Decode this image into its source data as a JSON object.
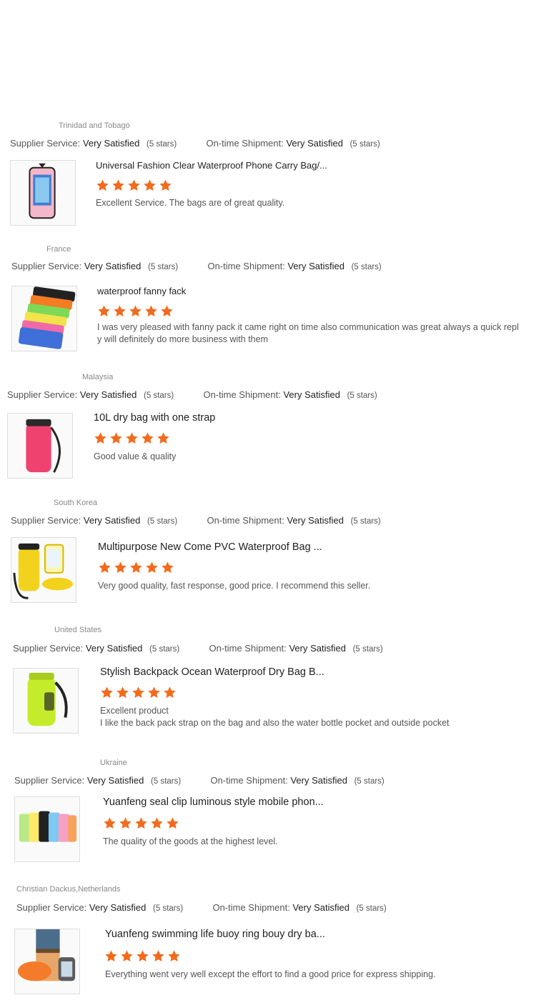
{
  "labels": {
    "supplier": "Supplier Service:",
    "shipment": "On-time Shipment:"
  },
  "colors": {
    "star": "#f26b1d",
    "accent_text": "#222222"
  },
  "reviews": [
    {
      "country": "Trinidad and Tobago",
      "supplier_value": "Very Satisfied",
      "supplier_stars": "(5 stars)",
      "shipment_value": "Very Satisfied",
      "shipment_stars": "(5 stars)",
      "product_title": "Universal Fashion Clear Waterproof Phone Carry Bag/...",
      "rating": 5,
      "comment_lines": [
        "Excellent Service. The bags are of great quality."
      ],
      "thumb_icon": "clear-phone-pouch-image"
    },
    {
      "country": "France",
      "supplier_value": "Very Satisfied",
      "supplier_stars": "(5 stars)",
      "shipment_value": "Very Satisfied",
      "shipment_stars": "(5 stars)",
      "product_title": "waterproof fanny fack",
      "rating": 5,
      "comment_lines": [
        "I was very pleased with fanny pack it came right on time also communication was great always a quick repl",
        "y will definitely do more business with them"
      ],
      "thumb_icon": "fanny-pack-image"
    },
    {
      "country": "Malaysia",
      "supplier_value": "Very Satisfied",
      "supplier_stars": "(5 stars)",
      "shipment_value": "Very Satisfied",
      "shipment_stars": "(5 stars)",
      "product_title": "10L dry bag with one strap",
      "rating": 5,
      "comment_lines": [
        "Good value & quality"
      ],
      "thumb_icon": "pink-dry-bag-image"
    },
    {
      "country": "South Korea",
      "supplier_value": "Very Satisfied",
      "supplier_stars": "(5 stars)",
      "shipment_value": "Very Satisfied",
      "shipment_stars": "(5 stars)",
      "product_title": "Multipurpose New Come PVC Waterproof Bag ...",
      "rating": 5,
      "comment_lines": [
        "Very good quality, fast response, good price. I recommend this seller."
      ],
      "thumb_icon": "yellow-bag-set-image"
    },
    {
      "country": "United States",
      "supplier_value": "Very Satisfied",
      "supplier_stars": "(5 stars)",
      "shipment_value": "Very Satisfied",
      "shipment_stars": "(5 stars)",
      "product_title": "Stylish Backpack Ocean Waterproof Dry Bag B...",
      "rating": 5,
      "comment_lines": [
        "Excellent product",
        "I like the back pack strap on the bag and also the water bottle pocket and outside pocket"
      ],
      "thumb_icon": "green-backpack-image"
    },
    {
      "country": "Ukraine",
      "supplier_value": "Very Satisfied",
      "supplier_stars": "(5 stars)",
      "shipment_value": "Very Satisfied",
      "shipment_stars": "(5 stars)",
      "product_title": "Yuanfeng seal clip luminous style mobile phon...",
      "rating": 5,
      "comment_lines": [
        "The quality of the goods at the highest level."
      ],
      "thumb_icon": "phone-cases-image"
    },
    {
      "country": "Christian Dackus,Netherlands",
      "supplier_value": "Very Satisfied",
      "supplier_stars": "(5 stars)",
      "shipment_value": "Very Satisfied",
      "shipment_stars": "(5 stars)",
      "product_title": "Yuanfeng swimming life buoy ring bouy dry ba...",
      "rating": 5,
      "comment_lines": [
        "Everything went very well except the effort to find a good price for express shipping."
      ],
      "thumb_icon": "buoy-bag-image"
    }
  ]
}
